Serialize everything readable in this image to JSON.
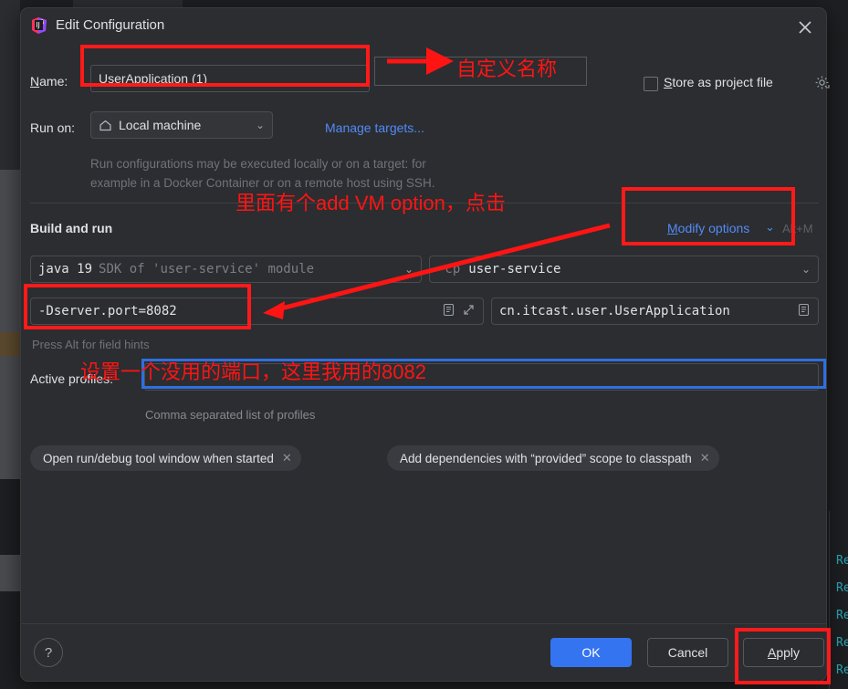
{
  "window": {
    "title": "Edit Configuration",
    "app_icon": "intellij-idea-icon",
    "close_icon": "close-icon"
  },
  "form": {
    "name_label": "Name:",
    "name_value": "UserApplication (1)",
    "run_on_label": "Run on:",
    "run_on_value": "Local machine",
    "run_on_icon": "home-icon",
    "manage_targets_link": "Manage targets...",
    "store_as_project_file_label": "Store as project file",
    "store_as_project_file_checked": false,
    "store_gear_icon": "gear-icon",
    "description_line1": "Run configurations may be executed locally or on a target: for",
    "description_line2": "example in a Docker Container or on a remote host using SSH."
  },
  "build_and_run": {
    "section_title": "Build and run",
    "modify_options_link": "Modify options",
    "modify_options_chevron": "chevron-down-icon",
    "modify_options_shortcut": "Alt+M",
    "jdk_value_bold": "java 19",
    "jdk_value_dim": "SDK of 'user-service' module",
    "classpath_prefix": "-cp",
    "classpath_value": "user-service",
    "vm_options_value": "-Dserver.port=8082",
    "vm_options_icon_1": "macro-list-icon",
    "vm_options_icon_2": "expand-editor-icon",
    "main_class_value": "cn.itcast.user.UserApplication",
    "main_class_icon": "browse-class-icon",
    "field_hint": "Press Alt for field hints"
  },
  "active_profiles": {
    "label": "Active profiles:",
    "value": "",
    "hint": "Comma separated list of profiles"
  },
  "chips": [
    {
      "label": "Open run/debug tool window when started",
      "remove_icon": "close-small-icon"
    },
    {
      "label": "Add dependencies with “provided” scope to classpath",
      "remove_icon": "close-small-icon"
    }
  ],
  "footer": {
    "help_label": "?",
    "ok_label": "OK",
    "cancel_label": "Cancel",
    "apply_label": "Apply"
  },
  "annotations": {
    "name_note": "自定义名称",
    "modify_note": "里面有个add VM option，点击",
    "port_note": "设置一个没用的端口，这里我用的8082",
    "red_color": "#ff1a1a",
    "blue_color": "#2f6fe0"
  },
  "background": {
    "code_lines": [
      "Re",
      "Re",
      "Re",
      "Re",
      "Re"
    ]
  }
}
